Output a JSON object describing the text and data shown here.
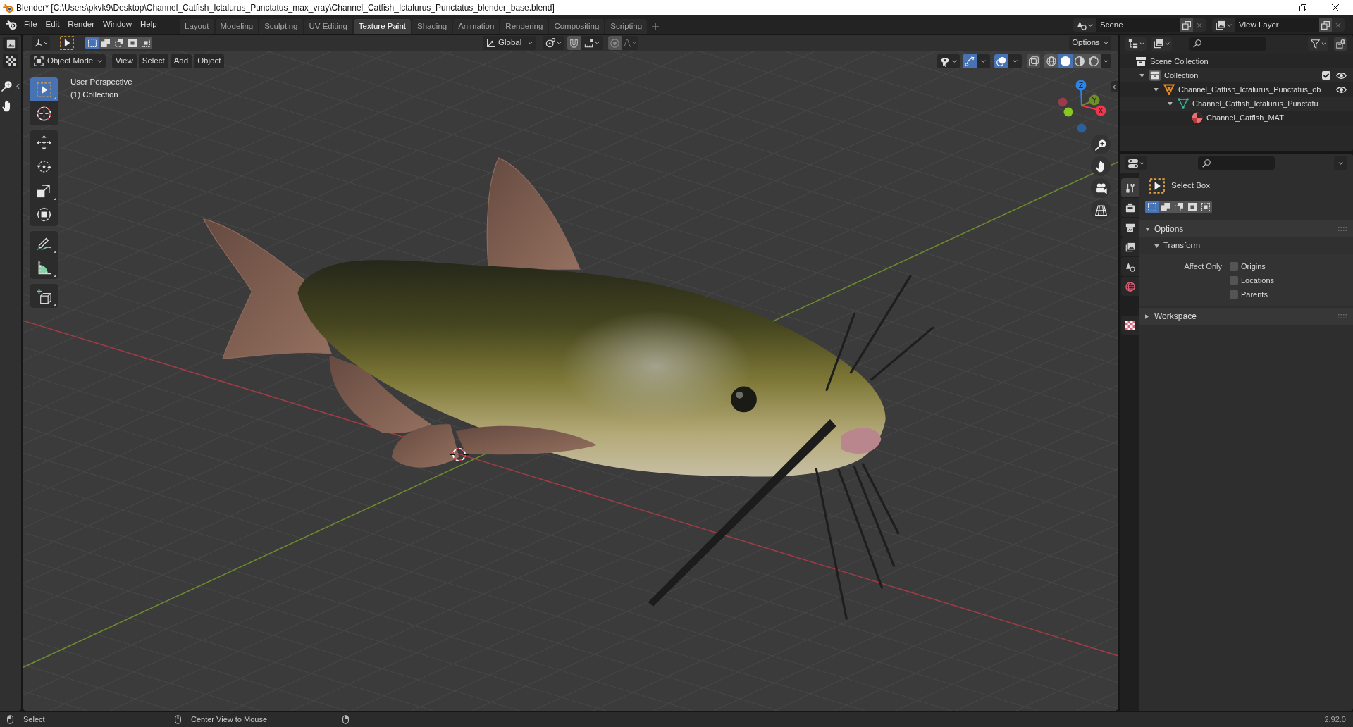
{
  "window": {
    "title": "Blender* [C:\\Users\\pkvk9\\Desktop\\Channel_Catfish_Ictalurus_Punctatus_max_vray\\Channel_Catfish_Ictalurus_Punctatus_blender_base.blend]"
  },
  "menu": [
    "File",
    "Edit",
    "Render",
    "Window",
    "Help"
  ],
  "workspace_tabs": [
    {
      "label": "Layout",
      "selected": false
    },
    {
      "label": "Modeling",
      "selected": false
    },
    {
      "label": "Sculpting",
      "selected": false
    },
    {
      "label": "UV Editing",
      "selected": false
    },
    {
      "label": "Texture Paint",
      "selected": true
    },
    {
      "label": "Shading",
      "selected": false
    },
    {
      "label": "Animation",
      "selected": false
    },
    {
      "label": "Rendering",
      "selected": false
    },
    {
      "label": "Compositing",
      "selected": false
    },
    {
      "label": "Scripting",
      "selected": false
    }
  ],
  "scene_selector": {
    "value": "Scene"
  },
  "view_layer_selector": {
    "value": "View Layer"
  },
  "tool_header": {
    "select_modes": [
      {
        "selected": true
      },
      {
        "selected": false
      },
      {
        "selected": false
      },
      {
        "selected": false
      },
      {
        "selected": false
      }
    ],
    "orientation": "Global",
    "options_label": "Options"
  },
  "view_header": {
    "mode": "Object Mode",
    "menus": [
      "View",
      "Select",
      "Add",
      "Object"
    ],
    "gizmos_on": true,
    "overlays_on": true,
    "xray_on": false,
    "shading": [
      {
        "kind": "wireframe",
        "selected": false
      },
      {
        "kind": "solid",
        "selected": true
      },
      {
        "kind": "material",
        "selected": false
      },
      {
        "kind": "rendered",
        "selected": false
      }
    ]
  },
  "toolbar": {
    "groups": [
      {
        "tools": [
          {
            "kind": "select_box",
            "selected": true,
            "more": true
          },
          {
            "kind": "cursor",
            "selected": false,
            "more": false
          }
        ]
      },
      {
        "tools": [
          {
            "kind": "move",
            "selected": false,
            "more": false
          },
          {
            "kind": "rotate",
            "selected": false,
            "more": false
          },
          {
            "kind": "scale",
            "selected": false,
            "more": true
          },
          {
            "kind": "transform",
            "selected": false,
            "more": false
          }
        ]
      },
      {
        "tools": [
          {
            "kind": "annotate",
            "selected": false,
            "more": true
          },
          {
            "kind": "measure",
            "selected": false,
            "more": true
          }
        ]
      },
      {
        "tools": [
          {
            "kind": "add_cube",
            "selected": false,
            "more": true
          }
        ]
      }
    ]
  },
  "viewport": {
    "info": [
      "User Perspective",
      "(1) Collection"
    ],
    "gizmo_axes": [
      {
        "label": "Z",
        "color": "#2e84e6"
      },
      {
        "label": "Y",
        "color": "#6e8e2a"
      },
      {
        "label": "X",
        "color": "#f0354e"
      }
    ],
    "gizmo_negative_axes": [
      {
        "color": "#9a3a4a"
      },
      {
        "color": "#86c81e"
      },
      {
        "color": "#2d5f9e"
      }
    ]
  },
  "outliner": {
    "tree": [
      {
        "label": "Scene Collection",
        "kind": "scene_collection",
        "children": [
          {
            "label": "Collection",
            "kind": "collection",
            "expanded": true,
            "checked": true,
            "visible": true,
            "children": [
              {
                "label": "Channel_Catfish_Ictalurus_Punctatus_ob",
                "kind": "object",
                "expanded": true,
                "visible": true,
                "children": [
                  {
                    "label": "Channel_Catfish_Ictalurus_Punctatu",
                    "kind": "mesh",
                    "expanded": true,
                    "children": [
                      {
                        "label": "Channel_Catfish_MAT",
                        "kind": "material"
                      }
                    ]
                  }
                ]
              }
            ]
          }
        ]
      }
    ]
  },
  "properties": {
    "tabs": [
      {
        "kind": "tool",
        "selected": true
      },
      {
        "kind": "render",
        "selected": false
      },
      {
        "kind": "output",
        "selected": false
      },
      {
        "kind": "view_layer",
        "selected": false
      },
      {
        "kind": "scene",
        "selected": false
      },
      {
        "kind": "world",
        "selected": false
      },
      {
        "kind": "texture",
        "selected": false
      }
    ],
    "tool": {
      "name": "Select Box",
      "select_modes": [
        {
          "selected": true
        },
        {
          "selected": false
        },
        {
          "selected": false
        },
        {
          "selected": false
        },
        {
          "selected": false
        }
      ]
    },
    "panels": [
      {
        "title": "Options",
        "expanded": true,
        "subpanels": [
          {
            "title": "Transform",
            "expanded": true,
            "label": "Affect Only",
            "checkboxes": [
              {
                "label": "Origins",
                "checked": false
              },
              {
                "label": "Locations",
                "checked": false
              },
              {
                "label": "Parents",
                "checked": false
              }
            ]
          }
        ]
      },
      {
        "title": "Workspace",
        "expanded": false
      }
    ]
  },
  "status_bar": {
    "hints": [
      "Select",
      "Center View to Mouse"
    ],
    "version": "2.92.0"
  }
}
